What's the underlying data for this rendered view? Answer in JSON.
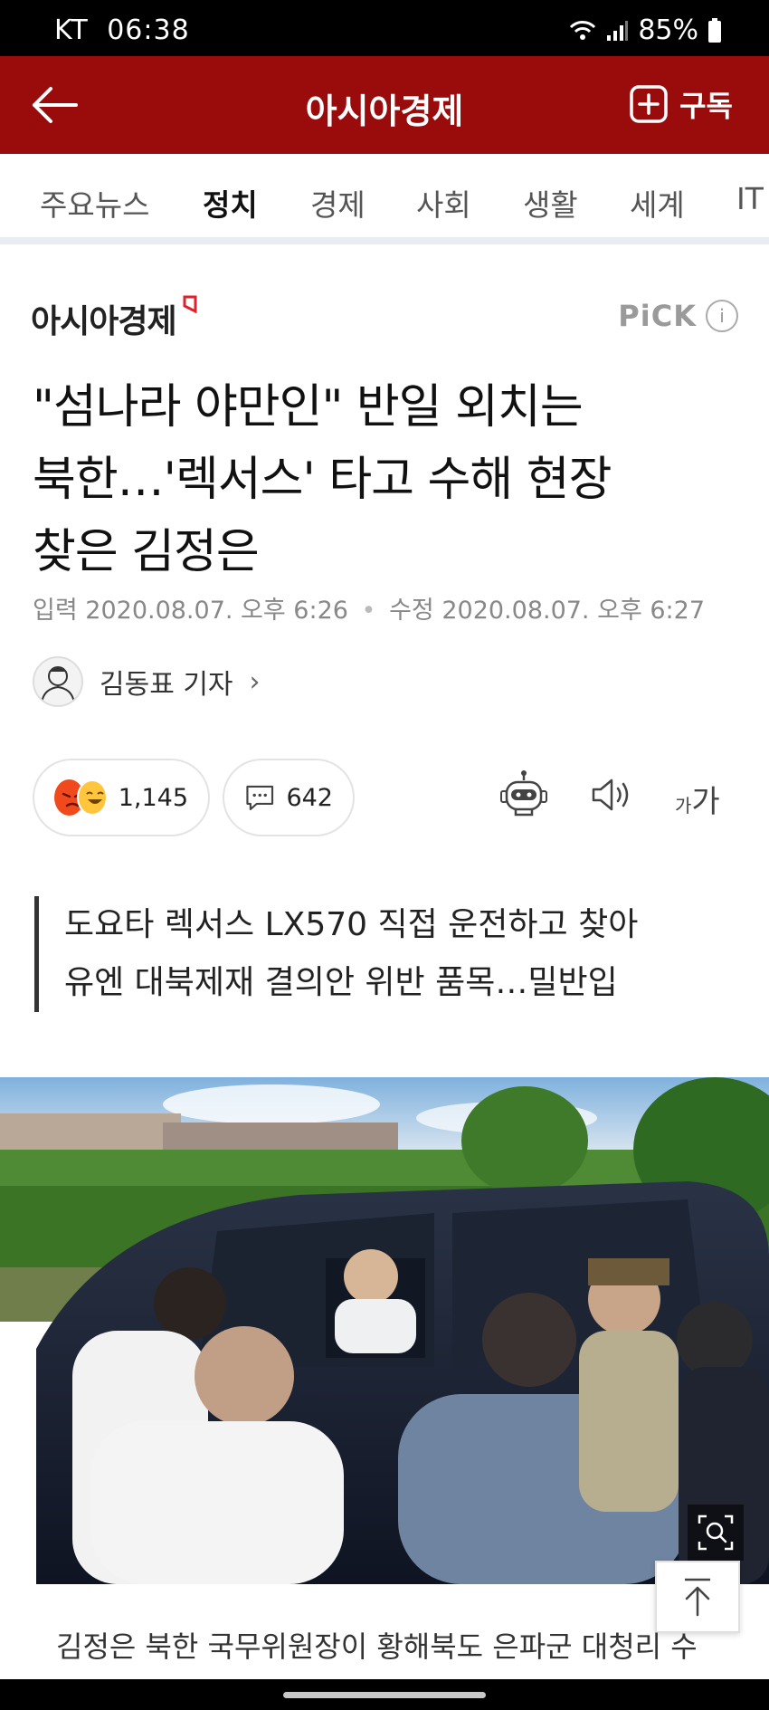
{
  "status_bar": {
    "carrier": "KT",
    "time": "06:38",
    "battery": "85%"
  },
  "app_bar": {
    "title": "아시아경제",
    "subscribe_label": "구독"
  },
  "tabs": [
    {
      "label": "주요뉴스",
      "active": false
    },
    {
      "label": "정치",
      "active": true
    },
    {
      "label": "경제",
      "active": false
    },
    {
      "label": "사회",
      "active": false
    },
    {
      "label": "생활",
      "active": false
    },
    {
      "label": "세계",
      "active": false
    },
    {
      "label": "IT",
      "active": false
    }
  ],
  "article": {
    "publisher": "아시아경제",
    "pick_label": "PiCK",
    "info_glyph": "i",
    "headline_lines": [
      "\"섬나라 야만인\" 반일 외치는",
      "북한…'렉서스' 타고 수해 현장",
      "찾은 김정은"
    ],
    "input_label": "입력",
    "input_date": "2020.08.07. 오후 6:26",
    "edit_label": "수정",
    "edit_date": "2020.08.07. 오후 6:27",
    "author": "김동표 기자",
    "author_chevron": "›",
    "reaction_count": "1,145",
    "comment_count": "642",
    "font_small": "가",
    "font_big": "가",
    "summary_lines": [
      "도요타 렉서스 LX570 직접 운전하고 찾아",
      "유엔 대북제재 결의안 위반 품목…밀반입"
    ],
    "body_preview": "김정은 북한 국무위원장이 황해북도 은파군 대청리 수"
  },
  "icons": {
    "back": "arrow-left-icon",
    "subscribe": "plus-square-icon",
    "robot": "robot-icon",
    "speaker": "speaker-icon",
    "zoom": "zoom-icon",
    "top": "arrow-up-icon",
    "comment": "speech-bubble-icon"
  },
  "colors": {
    "brand": "#9a0c0c",
    "logo_accent": "#e0202a"
  }
}
